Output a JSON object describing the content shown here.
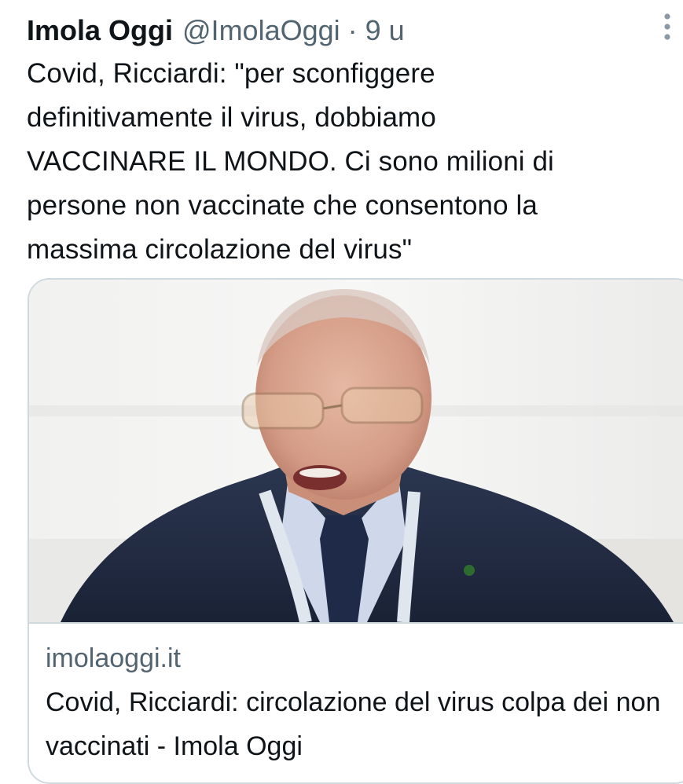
{
  "tweet": {
    "display_name": "Imola Oggi",
    "handle": "@ImolaOggi",
    "separator": "·",
    "time": "9 u",
    "more_icon": "more-vertical-icon",
    "text": "Covid, Ricciardi: \"per sconfiggere\ndefinitivamente il virus, dobbiamo\nVACCINARE IL MONDO. Ci sono milioni di\npersone non vaccinate che consentono la\nmassima circolazione del virus\""
  },
  "card": {
    "domain": "imolaoggi.it",
    "title": "Covid, Ricciardi: circolazione del virus colpa dei non vaccinati - Imola Oggi"
  },
  "colors": {
    "text_primary": "#0f1419",
    "text_secondary": "#536471",
    "border": "#cfd9de"
  }
}
